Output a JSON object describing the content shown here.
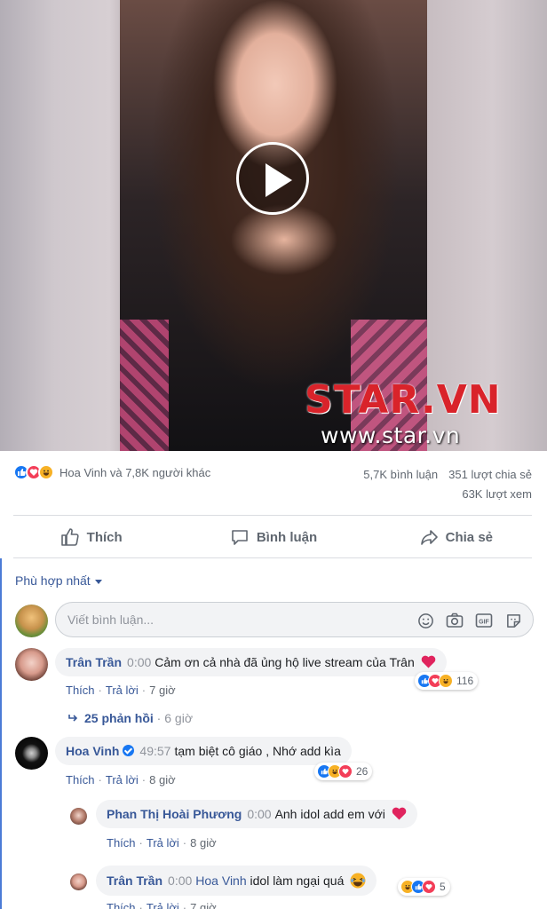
{
  "video": {
    "watermark_logo": "STAR.VN",
    "watermark_url": "www.star.vn"
  },
  "post_stats": {
    "reaction_summary": "Hoa Vinh và 7,8K người khác",
    "comments_count": "5,7K bình luận",
    "shares_count": "351 lượt chia sẻ",
    "views_count": "63K lượt xem",
    "reaction_icons": [
      "like-icon",
      "love-icon",
      "haha-icon"
    ]
  },
  "actions": {
    "like": "Thích",
    "comment": "Bình luận",
    "share": "Chia sẻ"
  },
  "comments_section": {
    "sort_label": "Phù hợp nhất",
    "input_placeholder": "Viết bình luận...",
    "input_icons": [
      "emoji-icon",
      "camera-icon",
      "gif-icon",
      "sticker-icon"
    ]
  },
  "comments": [
    {
      "author": "Trân Trần",
      "timestamp": "0:00",
      "text": "Cảm ơn cả nhà đã ủng hộ live stream của Trân",
      "emoji": "heart",
      "like_label": "Thích",
      "reply_label": "Trả lời",
      "age": "7 giờ",
      "reaction_count": "116",
      "replies_label": "25 phản hồi",
      "replies_age": "6 giờ"
    },
    {
      "author": "Hoa Vinh",
      "verified": true,
      "timestamp": "49:57",
      "text": "tạm biệt cô giáo , Nhớ add kìa",
      "like_label": "Thích",
      "reply_label": "Trả lời",
      "age": "8 giờ",
      "reaction_count": "26"
    },
    {
      "author": "Phan Thị Hoài Phương",
      "timestamp": "0:00",
      "text": "Anh idol add em với",
      "emoji": "heart",
      "like_label": "Thích",
      "reply_label": "Trả lời",
      "age": "8 giờ"
    },
    {
      "author": "Trân Trần",
      "timestamp": "0:00",
      "mention": "Hoa Vinh",
      "text": "idol làm ngại quá",
      "emoji": "laugh",
      "like_label": "Thích",
      "reply_label": "Trả lời",
      "age": "7 giờ",
      "reaction_count": "5"
    }
  ],
  "colors": {
    "link": "#385898",
    "like_blue": "#1877f2",
    "love_red": "#f33e58",
    "haha_yellow": "#f7b125",
    "watermark_red": "#d9232a"
  }
}
